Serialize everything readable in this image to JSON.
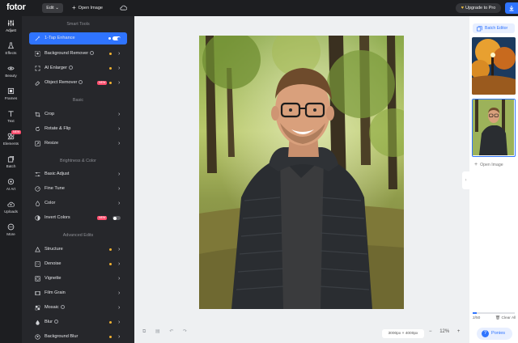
{
  "app": {
    "logo": "fotor",
    "edit_label": "Edit",
    "open_image_label": "Open Image",
    "upgrade_label": "Upgrade to Pro"
  },
  "rail": [
    {
      "label": "Adjust",
      "icon": "sliders-icon"
    },
    {
      "label": "Effects",
      "icon": "flask-icon"
    },
    {
      "label": "Beauty",
      "icon": "eye-icon"
    },
    {
      "label": "Frames",
      "icon": "frame-icon"
    },
    {
      "label": "Text",
      "icon": "text-icon"
    },
    {
      "label": "Elements",
      "icon": "shapes-icon",
      "badge": "NEW"
    },
    {
      "label": "Batch",
      "icon": "batch-icon"
    },
    {
      "label": "AI Art",
      "icon": "ai-art-icon"
    },
    {
      "label": "Uploads",
      "icon": "cloud-upload-icon"
    },
    {
      "label": "More",
      "icon": "more-icon"
    }
  ],
  "panel": {
    "sections": {
      "smart_tools": "Smart Tools",
      "basic": "Basic",
      "brightness": "Brightness & Color",
      "advanced": "Advanced Edits"
    },
    "items": [
      {
        "label": "1-Tap Enhance"
      },
      {
        "label": "Background Remover"
      },
      {
        "label": "AI Enlarger"
      },
      {
        "label": "Object Remover",
        "badge": "NEW"
      },
      {
        "label": "Crop"
      },
      {
        "label": "Rotate & Flip"
      },
      {
        "label": "Resize"
      },
      {
        "label": "Basic Adjust"
      },
      {
        "label": "Fine Tune"
      },
      {
        "label": "Color"
      },
      {
        "label": "Invert Colors",
        "badge": "NEW"
      },
      {
        "label": "Structure"
      },
      {
        "label": "Denoise"
      },
      {
        "label": "Vignette"
      },
      {
        "label": "Film Grain"
      },
      {
        "label": "Mosaic"
      },
      {
        "label": "Blur"
      },
      {
        "label": "Background Blur"
      }
    ]
  },
  "canvas": {
    "dimensions": "3000px × 4000px",
    "zoom": "12%"
  },
  "right": {
    "batch_label": "Batch Editor",
    "open_image_label": "Open Image",
    "count": "2/50",
    "clear_label": "Clear All",
    "help_label": "Ponies"
  },
  "colors": {
    "accent": "#2f74ff",
    "panel": "#26272b",
    "badge": "#ff4d6d",
    "premium_dot": "#f4b331"
  }
}
